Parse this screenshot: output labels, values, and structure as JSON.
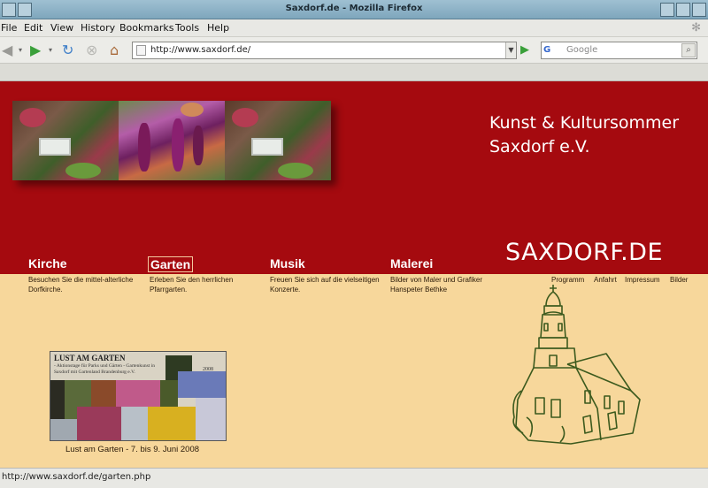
{
  "window": {
    "title": "Saxdorf.de - Mozilla Firefox"
  },
  "menu": {
    "items": [
      "File",
      "Edit",
      "View",
      "History",
      "Bookmarks",
      "Tools",
      "Help"
    ]
  },
  "toolbar": {
    "url": "http://www.saxdorf.de/",
    "search_placeholder": "Google",
    "search_engine_label": "G"
  },
  "site": {
    "name_line1": "Kunst & Kultursommer",
    "name_line2": "Saxdorf e.V.",
    "brand": "SAXDORF.DE",
    "nav": [
      {
        "title": "Kirche",
        "desc": "Besuchen Sie die mittel-alterliche Dorfkirche."
      },
      {
        "title": "Garten",
        "desc": "Erleben Sie den herrlichen Pfarrgarten."
      },
      {
        "title": "Musik",
        "desc": "Freuen Sie sich auf die vielseitigen Konzerte."
      },
      {
        "title": "Malerei",
        "desc": "Bilder von Maler und Grafiker Hanspeter Bethke"
      }
    ],
    "links": [
      "Programm",
      "Anfahrt",
      "Impressum",
      "Bilder"
    ],
    "poster": {
      "headline": "LUST AM GARTEN",
      "subtitle": "- Aktionstage für Parks und Gärten - Gartenkunst in Saxdorf mit Gartenland Brandenburg e.V.",
      "year": "2008",
      "caption": "Lust am Garten - 7. bis 9. Juni 2008"
    }
  },
  "status": {
    "text": "http://www.saxdorf.de/garten.php"
  }
}
